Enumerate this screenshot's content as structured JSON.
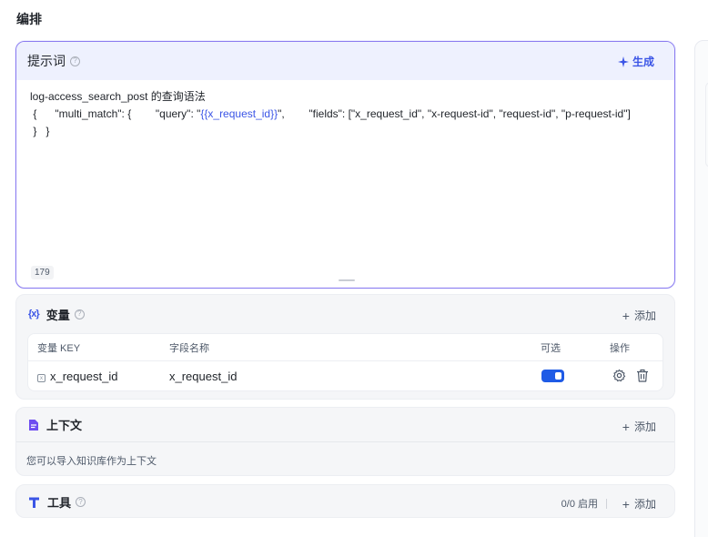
{
  "page": {
    "title": "编排"
  },
  "prompt": {
    "title": "提示词",
    "generate_label": "生成",
    "line1": "log-access_search_post 的查询语法",
    "line2_pre": " {      \"multi_match\": {        \"query\": \"",
    "line2_var": "{{x_request_id}}",
    "line2_post": "\",        \"fields\": [\"x_request_id\", \"x-request-id\", \"request-id\", \"p-request-id\"]",
    "line3": " }   }",
    "char_count": "179"
  },
  "variables": {
    "title": "变量",
    "icon_text": "{x}",
    "add_label": "添加",
    "columns": {
      "key": "变量 KEY",
      "name": "字段名称",
      "optional": "可选",
      "actions": "操作"
    },
    "rows": [
      {
        "key": "x_request_id",
        "name": "x_request_id",
        "optional": true
      }
    ]
  },
  "context": {
    "title": "上下文",
    "add_label": "添加",
    "hint": "您可以导入知识库作为上下文"
  },
  "tools": {
    "title": "工具",
    "count_label": "0/0 启用",
    "add_label": "添加"
  },
  "colors": {
    "accent": "#3b55e6",
    "toggle": "#1f5be6",
    "border_focus": "#8b7bf0"
  }
}
